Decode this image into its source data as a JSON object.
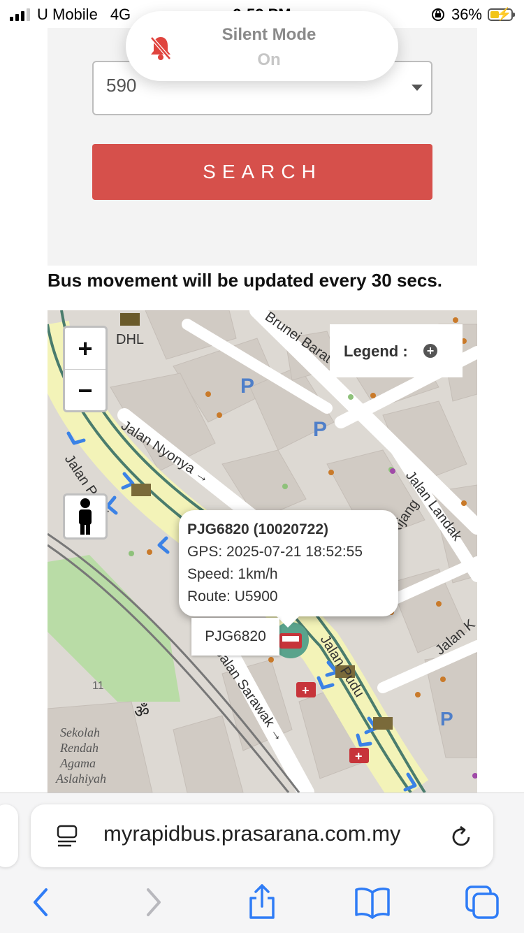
{
  "status_bar": {
    "carrier": "U Mobile",
    "network": "4G",
    "time": "9:52 PM",
    "battery_percent": "36%",
    "battery_level": 0.36,
    "icons": [
      "signal-icon",
      "orientation-lock-icon",
      "battery-charging-icon"
    ]
  },
  "silent_mode": {
    "title": "Silent Mode",
    "state": "On",
    "icon": "bell-slash-icon",
    "icon_color": "#e0443e"
  },
  "form": {
    "route_value": "590",
    "search_label": "SEARCH",
    "button_color": "#d6504b"
  },
  "notice": "Bus movement will be updated every 30 secs.",
  "map": {
    "zoom_in": "+",
    "zoom_out": "−",
    "legend_label": "Legend :",
    "legend_toggle": "+",
    "street_labels": [
      "Jalan Brunei Barat",
      "Jalan Nyonya",
      "Jalan Pudu",
      "Jalan Landak",
      "Jalan Sarawak",
      "Jalan Kijang",
      "Jalan K"
    ],
    "poi_labels": [
      "DHL",
      "Sekolah",
      "Rendah",
      "Agama",
      "Aslahiyah",
      "11"
    ],
    "route_color": "#4a7c6d",
    "route_highlight": "#f3f3b8",
    "direction_arrow_color": "#3b82e6",
    "bus_popup": {
      "title": "PJG6820 (10020722)",
      "gps": "GPS: 2025-07-21 18:52:55",
      "speed": "Speed: 1km/h",
      "route": "Route: U5900"
    },
    "bus_label": "PJG6820"
  },
  "browser": {
    "url": "myrapidbus.prasarana.com.my",
    "toolbar": [
      "back-icon",
      "forward-icon",
      "share-icon",
      "bookmarks-icon",
      "tabs-icon"
    ],
    "accent": "#2f7cf6"
  }
}
